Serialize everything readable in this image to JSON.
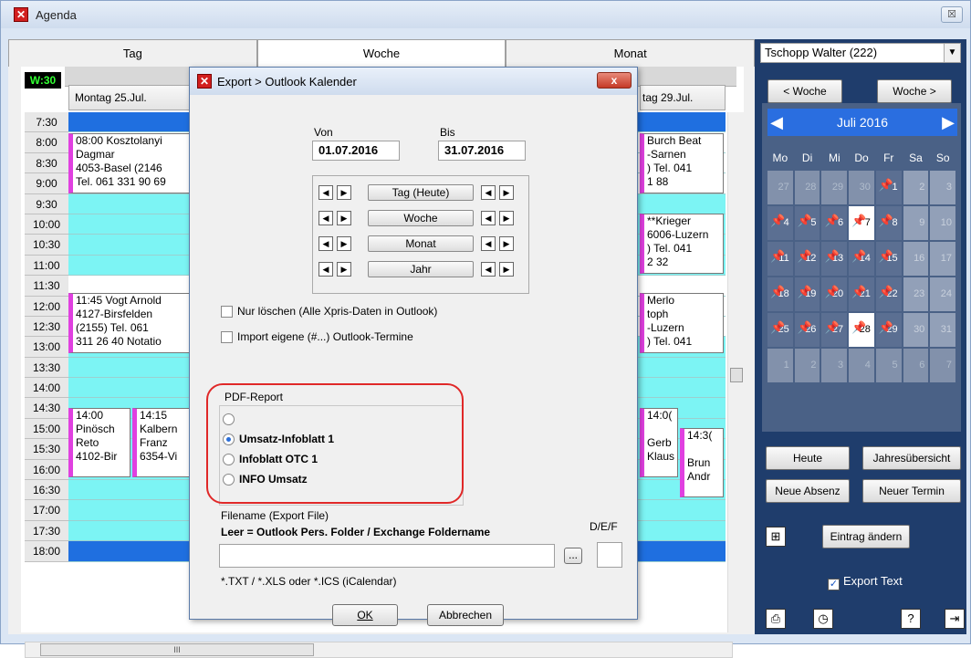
{
  "window": {
    "title": "Agenda",
    "close_glyph": "☒"
  },
  "tabs": [
    "Tag",
    "Woche",
    "Monat"
  ],
  "calendar": {
    "week_badge": "W:30",
    "days": [
      "Montag 25.Jul.",
      "tag 29.Jul."
    ],
    "times": [
      "7:30",
      "8:00",
      "8:30",
      "9:00",
      "9:30",
      "10:00",
      "10:30",
      "11:00",
      "11:30",
      "12:00",
      "12:30",
      "13:00",
      "13:30",
      "14:00",
      "14:30",
      "15:00",
      "15:30",
      "16:00",
      "16:30",
      "17:00",
      "17:30",
      "18:00"
    ],
    "appointments_mon": [
      {
        "text": "08:00 Kosztolanyi\nDagmar\n4053-Basel (2146\nTel. 061 331 90 69"
      },
      {
        "text": "11:45 Vogt Arnold\n4127-Birsfelden\n(2155) Tel. 061\n311 26 40 Notatio"
      },
      {
        "text": "14:00\nPinösch\nReto\n4102-Bir"
      },
      {
        "text": "14:15\nKalbern\nFranz\n6354-Vi"
      }
    ],
    "appointments_fri": [
      {
        "text": "Burch Beat\n-Sarnen\n) Tel. 041\n1 88"
      },
      {
        "text": "**Krieger\n6006-Luzern\n) Tel. 041\n2 32"
      },
      {
        "text": "Merlo\ntoph\n-Luzern\n) Tel. 041"
      },
      {
        "text": "14:0(\n\nGerb\nKlaus"
      },
      {
        "text": "14:3(\n\nBrun\nAndr"
      }
    ],
    "hscroll_mid": "III"
  },
  "sidebar": {
    "user_select": "Tschopp Walter  (222)",
    "prev_week": "< Woche",
    "next_week": "Woche >",
    "month_title": "Juli 2016",
    "weekday_headers": [
      "Mo",
      "Di",
      "Mi",
      "Do",
      "Fr",
      "Sa",
      "So"
    ],
    "weeks": [
      [
        "27",
        "28",
        "29",
        "30",
        "1",
        "2",
        "3"
      ],
      [
        "4",
        "5",
        "6",
        "7",
        "8",
        "9",
        "10"
      ],
      [
        "11",
        "12",
        "13",
        "14",
        "15",
        "16",
        "17"
      ],
      [
        "18",
        "19",
        "20",
        "21",
        "22",
        "23",
        "24"
      ],
      [
        "25",
        "26",
        "27",
        "28",
        "29",
        "30",
        "31"
      ],
      [
        "1",
        "2",
        "3",
        "4",
        "5",
        "6",
        "7"
      ]
    ],
    "btn_heute": "Heute",
    "btn_jahres": "Jahresübersicht",
    "btn_absenz": "Neue Absenz",
    "btn_termin": "Neuer Termin",
    "btn_eintrag": "Eintrag ändern",
    "export_text": "Export Text",
    "check_glyph": "✓"
  },
  "dialog": {
    "title": "Export > Outlook Kalender",
    "close_glyph": "x",
    "von_label": "Von",
    "bis_label": "Bis",
    "von_value": "01.07.2016",
    "bis_value": "31.07.2016",
    "nav_buttons": [
      "Tag (Heute)",
      "Woche",
      "Monat",
      "Jahr"
    ],
    "nur_loeschen": "Nur löschen  (Alle Xpris-Daten in Outlook)",
    "import_eigene": "Import eigene (#...) Outlook-Termine",
    "pdf_report_label": "PDF-Report",
    "pdf_options": [
      "Umsatz-Infoblatt 1",
      "Infoblatt OTC 1",
      "INFO Umsatz"
    ],
    "filename_label": "Filename (Export File)",
    "filename_hint": "Leer = Outlook Pers. Folder / Exchange Foldername",
    "def_label": "D/E/F",
    "browse_label": "...",
    "file_types": "*.TXT / *.XLS oder *.ICS (iCalendar)",
    "ok_label": "OK",
    "cancel_label": "Abbrechen"
  }
}
